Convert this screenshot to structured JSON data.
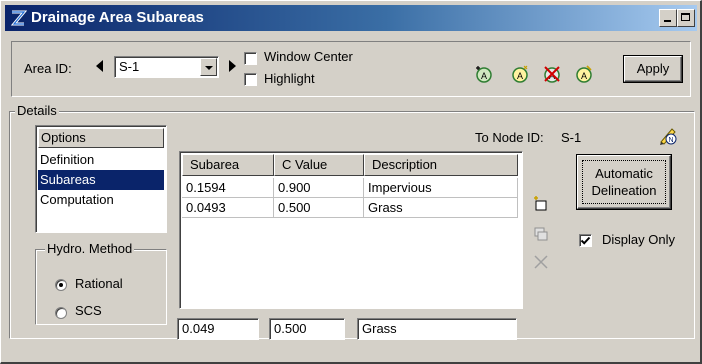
{
  "window": {
    "title": "Drainage Area Subareas"
  },
  "toolbar": {
    "area_id_label": "Area ID:",
    "area_id_value": "S-1",
    "window_center_label": "Window Center",
    "window_center_checked": false,
    "highlight_label": "Highlight",
    "highlight_checked": false,
    "apply_label": "Apply"
  },
  "details": {
    "title": "Details",
    "to_node_label": "To Node ID:",
    "to_node_value": "S-1",
    "options": {
      "header": "Options",
      "items": [
        "Definition",
        "Subareas",
        "Computation"
      ],
      "selected": "Subareas"
    },
    "hydro_method": {
      "title": "Hydro. Method",
      "options": [
        "Rational",
        "SCS"
      ],
      "selected": "Rational"
    },
    "table": {
      "columns": [
        "Subarea",
        "C Value",
        "Description"
      ],
      "rows": [
        [
          "0.1594",
          "0.900",
          "Impervious"
        ],
        [
          "0.0493",
          "0.500",
          "Grass"
        ]
      ]
    },
    "edit": {
      "subarea": "0.049",
      "c_value": "0.500",
      "description": "Grass"
    },
    "auto_delineation_line1": "Automatic",
    "auto_delineation_line2": "Delineation",
    "display_only_label": "Display Only",
    "display_only_checked": true
  },
  "colors": {
    "face": "#d4d0c8",
    "title_start": "#0a246a",
    "title_end": "#a6caf0",
    "selection": "#0a246a"
  }
}
